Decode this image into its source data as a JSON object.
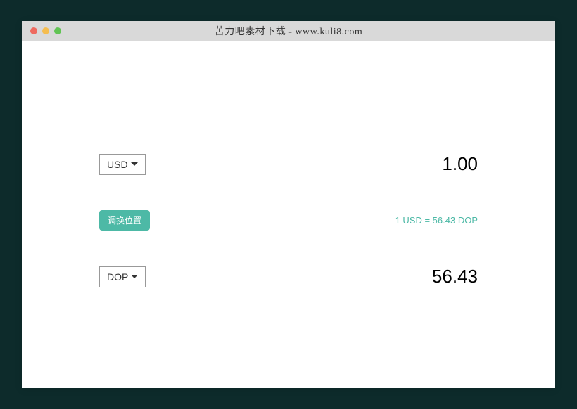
{
  "titlebar": {
    "title": "苦力吧素材下载 - www.kuli8.com"
  },
  "converter": {
    "fromCurrency": "USD",
    "fromValue": "1.00",
    "swapLabel": "调换位置",
    "rateText": "1 USD = 56.43 DOP",
    "toCurrency": "DOP",
    "toValue": "56.43"
  }
}
